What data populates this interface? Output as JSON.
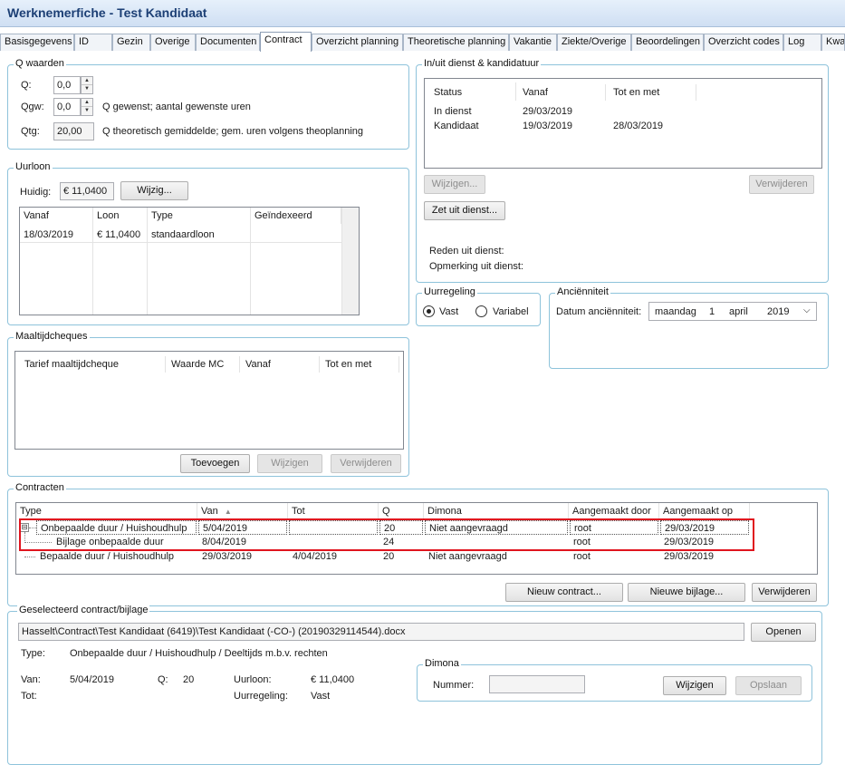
{
  "window": {
    "title": "Werknemerfiche - Test Kandidaat"
  },
  "tabs": [
    {
      "label": "Basisgegevens"
    },
    {
      "label": "ID"
    },
    {
      "label": "Gezin"
    },
    {
      "label": "Overige"
    },
    {
      "label": "Documenten"
    },
    {
      "label": "Contract"
    },
    {
      "label": "Overzicht planning"
    },
    {
      "label": "Theoretische planning"
    },
    {
      "label": "Vakantie"
    },
    {
      "label": "Ziekte/Overige"
    },
    {
      "label": "Beoordelingen"
    },
    {
      "label": "Overzicht codes"
    },
    {
      "label": "Log"
    },
    {
      "label": "Kwa"
    }
  ],
  "active_tab": "Contract",
  "q_values": {
    "title": "Q waarden",
    "q_label": "Q:",
    "q_value": "0,0",
    "qgw_label": "Qgw:",
    "qgw_value": "0,0",
    "qgw_desc": "Q gewenst; aantal gewenste uren",
    "qtg_label": "Qtg:",
    "qtg_value": "20,00",
    "qtg_desc": "Q theoretisch gemiddelde; gem. uren volgens theoplanning"
  },
  "uurloon": {
    "title": "Uurloon",
    "current_label": "Huidig:",
    "current_value": "€ 11,0400",
    "edit_button": "Wijzig...",
    "columns": [
      "Vanaf",
      "Loon",
      "Type",
      "Geïndexeerd"
    ],
    "rows": [
      [
        "18/03/2019",
        "€ 11,0400",
        "standaardloon",
        ""
      ]
    ]
  },
  "maaltijdcheques": {
    "title": "Maaltijdcheques",
    "columns": [
      "Tarief maaltijdcheque",
      "Waarde MC",
      "Vanaf",
      "Tot en met"
    ],
    "add_button": "Toevoegen",
    "edit_button": "Wijzigen",
    "delete_button": "Verwijderen"
  },
  "inuit": {
    "title": "In/uit dienst & kandidatuur",
    "columns": [
      "Status",
      "Vanaf",
      "Tot en met"
    ],
    "rows": [
      [
        "In dienst",
        "29/03/2019",
        ""
      ],
      [
        "Kandidaat",
        "19/03/2019",
        "28/03/2019"
      ]
    ],
    "edit_button": "Wijzigen...",
    "delete_button": "Verwijderen",
    "out_button": "Zet uit dienst...",
    "reason_label": "Reden uit dienst:",
    "remark_label": "Opmerking uit dienst:"
  },
  "uurregeling": {
    "title": "Uurregeling",
    "options": [
      {
        "label": "Vast",
        "selected": true
      },
      {
        "label": "Variabel",
        "selected": false
      }
    ]
  },
  "ancienniteit": {
    "title": "Anciënniteit",
    "date_label": "Datum anciënniteit:",
    "weekday": "maandag",
    "day": "1",
    "month": "april",
    "year": "2019"
  },
  "contracten": {
    "title": "Contracten",
    "columns": [
      "Type",
      "Van",
      "Tot",
      "Q",
      "Dimona",
      "Aangemaakt door",
      "Aangemaakt op"
    ],
    "sort_column": "Van",
    "rows": [
      {
        "type": "Onbepaalde duur / Huishoudhulp",
        "van": "5/04/2019",
        "tot": "",
        "q": "20",
        "dimona": "Niet aangevraagd",
        "door": "root",
        "op": "29/03/2019",
        "level": 0,
        "expander": "⊟",
        "highlighted": true
      },
      {
        "type": "Bijlage onbepaalde duur",
        "van": "8/04/2019",
        "tot": "",
        "q": "24",
        "dimona": "",
        "door": "root",
        "op": "29/03/2019",
        "level": 1,
        "expander": "",
        "highlighted": true
      },
      {
        "type": "Bepaalde duur / Huishoudhulp",
        "van": "29/03/2019",
        "tot": "4/04/2019",
        "q": "20",
        "dimona": "Niet aangevraagd",
        "door": "root",
        "op": "29/03/2019",
        "level": 0,
        "expander": "",
        "highlighted": false
      }
    ],
    "new_contract_button": "Nieuw contract...",
    "new_attachment_button": "Nieuwe bijlage...",
    "delete_button": "Verwijderen",
    "highlight_color": "#e0141e"
  },
  "selected": {
    "title": "Geselecteerd contract/bijlage",
    "path": "Hasselt\\Contract\\Test Kandidaat (6419)\\Test Kandidaat (-CO-) (20190329114544).docx",
    "open_button": "Openen",
    "type_label": "Type:",
    "type_value": "Onbepaalde duur / Huishoudhulp / Deeltijds m.b.v. rechten",
    "van_label": "Van:",
    "van_value": "5/04/2019",
    "tot_label": "Tot:",
    "tot_value": "",
    "q_label": "Q:",
    "q_value": "20",
    "uurloon_label": "Uurloon:",
    "uurloon_value": "€ 11,0400",
    "uurregeling_label": "Uurregeling:",
    "uurregeling_value": "Vast"
  },
  "dimona": {
    "title": "Dimona",
    "number_label": "Nummer:",
    "number_value": "",
    "edit_button": "Wijzigen",
    "save_button": "Opslaan"
  }
}
